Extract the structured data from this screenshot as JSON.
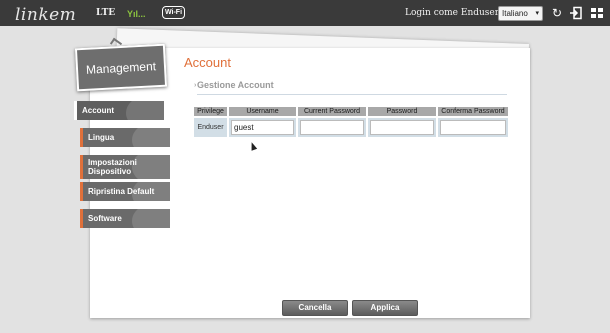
{
  "header": {
    "logo": "linkem",
    "network": "LTE",
    "signal": "Yıl...",
    "wifi_label": "Wi-Fi",
    "login_text": "Login come Enduser",
    "language": {
      "selected": "Italiano"
    },
    "icons": [
      "refresh-icon",
      "logout-icon",
      "grid-menu-icon"
    ]
  },
  "panel": {
    "title": "Management"
  },
  "sidebar": {
    "items": [
      {
        "label": "Account",
        "active": true
      },
      {
        "label": "Lingua"
      },
      {
        "label": "Impostazioni Dispositivo"
      },
      {
        "label": "Ripristina Default"
      },
      {
        "label": "Software"
      }
    ]
  },
  "main": {
    "title": "Account",
    "section": "Gestione Account",
    "table": {
      "headers": [
        "Privilege",
        "Username",
        "Current Password",
        "Password",
        "Conferma Password"
      ],
      "rows": [
        {
          "privilege": "Enduser",
          "username": "guest",
          "current_password": "",
          "password": "",
          "confirm_password": ""
        }
      ]
    },
    "buttons": {
      "cancel": "Cancella",
      "apply": "Applica"
    }
  },
  "colors": {
    "accent": "#e0703a",
    "topbar": "#3a3a3a",
    "sidebar": "#6a6a6a",
    "row_bg": "#d2dee6"
  }
}
